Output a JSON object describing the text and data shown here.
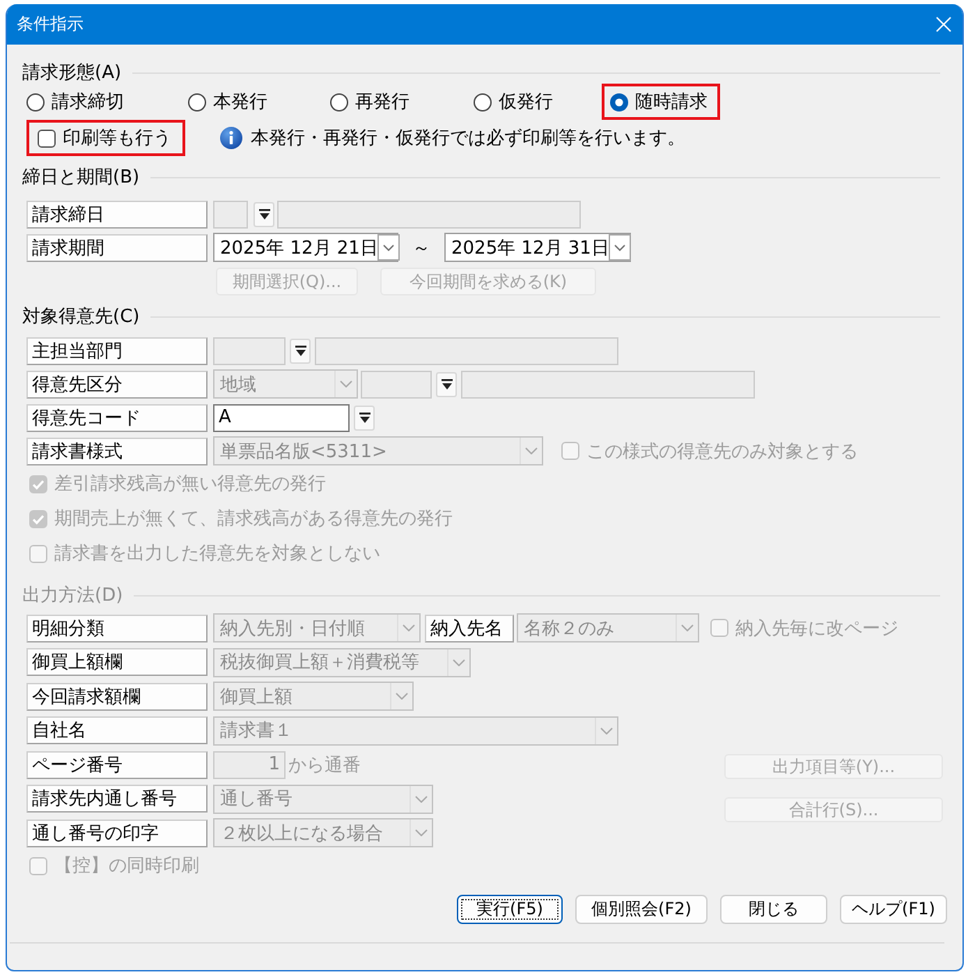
{
  "window": {
    "title": "条件指示"
  },
  "billing_type": {
    "label": "請求形態(A)",
    "disabled": false,
    "options": [
      {
        "label": "請求締切",
        "selected": false,
        "highlighted": false
      },
      {
        "label": "本発行",
        "selected": false,
        "highlighted": false
      },
      {
        "label": "再発行",
        "selected": false,
        "highlighted": false
      },
      {
        "label": "仮発行",
        "selected": false,
        "highlighted": false
      },
      {
        "label": "随時請求",
        "selected": true,
        "highlighted": true
      }
    ],
    "print_option": {
      "label": "印刷等も行う",
      "checked": false,
      "disabled": false,
      "highlighted": true
    },
    "notice": "本発行・再発行・仮発行では必ず印刷等を行います。"
  },
  "closing_period": {
    "label": "締日と期間(B)",
    "disabled": false,
    "closing_day": {
      "label": "請求締日",
      "code": {
        "disabled": true
      },
      "name": {
        "disabled": true
      }
    },
    "period": {
      "label": "請求期間",
      "from": "2025年 12月 21日",
      "separator": "～",
      "to": "2025年 12月 31日",
      "disabled": false
    },
    "buttons": [
      {
        "label": "期間選択(Q)...",
        "disabled": true
      },
      {
        "label": "今回期間を求める(K)",
        "disabled": true
      }
    ]
  },
  "customer": {
    "label": "対象得意先(C)",
    "disabled": false,
    "department": {
      "label": "主担当部門",
      "code": {
        "disabled": true
      },
      "name": {
        "disabled": true
      }
    },
    "category": {
      "label": "得意先区分",
      "type": {
        "value": "地域",
        "disabled": true
      },
      "code": {
        "disabled": true
      },
      "name": {
        "disabled": true
      }
    },
    "customer_code": {
      "label": "得意先コード",
      "value": "A",
      "disabled": false
    },
    "invoice_format": {
      "label": "請求書様式",
      "value": "単票品名版<5311>",
      "disabled": true
    },
    "format_only": {
      "label": "この様式の得意先のみ対象とする",
      "checked": false,
      "disabled": true
    },
    "options": [
      {
        "label": "差引請求残高が無い得意先の発行",
        "checked": true,
        "disabled": true
      },
      {
        "label": "期間売上が無くて、請求残高がある得意先の発行",
        "checked": true,
        "disabled": true
      },
      {
        "label": "請求書を出力した得意先を対象としない",
        "checked": false,
        "disabled": true
      }
    ]
  },
  "output": {
    "label": "出力方法(D)",
    "disabled": true,
    "detail_class": {
      "label": "明細分類",
      "value": "納入先別・日付順",
      "disabled": true
    },
    "delivery_name": {
      "label": "納入先名",
      "value": "名称２のみ",
      "disabled": true
    },
    "page_break": {
      "label": "納入先毎に改ページ",
      "checked": false,
      "disabled": true
    },
    "purchase_column": {
      "label": "御買上額欄",
      "value": "税抜御買上額＋消費税等",
      "disabled": true
    },
    "current_column": {
      "label": "今回請求額欄",
      "value": "御買上額",
      "disabled": true
    },
    "company_name": {
      "label": "自社名",
      "value": "請求書１",
      "disabled": true
    },
    "page_number": {
      "label": "ページ番号",
      "value": "1",
      "suffix": "から通番",
      "disabled": true
    },
    "serial_number": {
      "label": "請求先内通し番号",
      "value": "通し番号",
      "disabled": true
    },
    "serial_print": {
      "label": "通し番号の印字",
      "value": "２枚以上になる場合",
      "disabled": true
    },
    "copy_print": {
      "label": "【控】の同時印刷",
      "checked": false,
      "disabled": true
    },
    "side_buttons": [
      {
        "label": "出力項目等(Y)...",
        "disabled": true
      },
      {
        "label": "合計行(S)...",
        "disabled": true
      }
    ]
  },
  "buttons": [
    {
      "label": "実行(F5)",
      "default": true
    },
    {
      "label": "個別照会(F2)",
      "default": false
    },
    {
      "label": "閉じる",
      "default": false
    },
    {
      "label": "ヘルプ(F1)",
      "default": false
    }
  ]
}
